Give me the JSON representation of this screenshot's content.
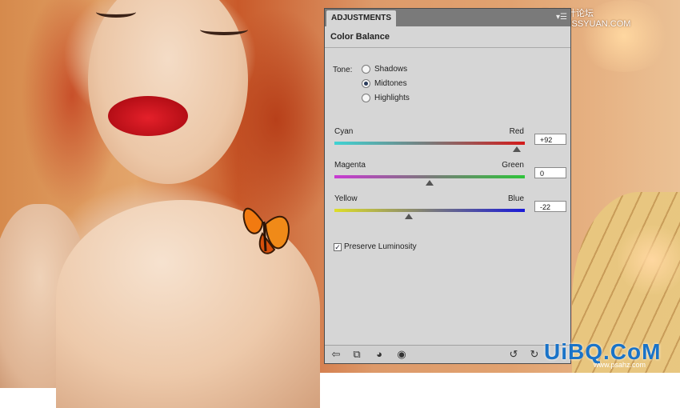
{
  "watermark": {
    "top": "思缘设计论坛 www.MISSYUAN.COM",
    "bottom": "UiBQ.CoM",
    "url": "www.psahz.com"
  },
  "panel": {
    "tab": "ADJUSTMENTS",
    "menu_icon": "panel-menu-icon",
    "title": "Color Balance",
    "tone": {
      "label": "Tone:",
      "options": [
        "Shadows",
        "Midtones",
        "Highlights"
      ],
      "selected": "Midtones"
    },
    "sliders": [
      {
        "left": "Cyan",
        "right": "Red",
        "value": "+92",
        "numeric": 92,
        "colors": [
          "#3fd3d3",
          "#7a7a7a",
          "#d41a1a"
        ]
      },
      {
        "left": "Magenta",
        "right": "Green",
        "value": "0",
        "numeric": 0,
        "colors": [
          "#c93ad3",
          "#7a7a7a",
          "#2ec43a"
        ]
      },
      {
        "left": "Yellow",
        "right": "Blue",
        "value": "-22",
        "numeric": -22,
        "colors": [
          "#dede2a",
          "#7a7a7a",
          "#1a1ad8"
        ]
      }
    ],
    "preserve_luminosity": {
      "label": "Preserve Luminosity",
      "checked": true
    },
    "bottom_icons": [
      "back-arrow-icon",
      "clip-to-layer-icon",
      "layer-visibility-toggle-icon",
      "eye-icon",
      "previous-state-icon",
      "reset-icon"
    ]
  }
}
